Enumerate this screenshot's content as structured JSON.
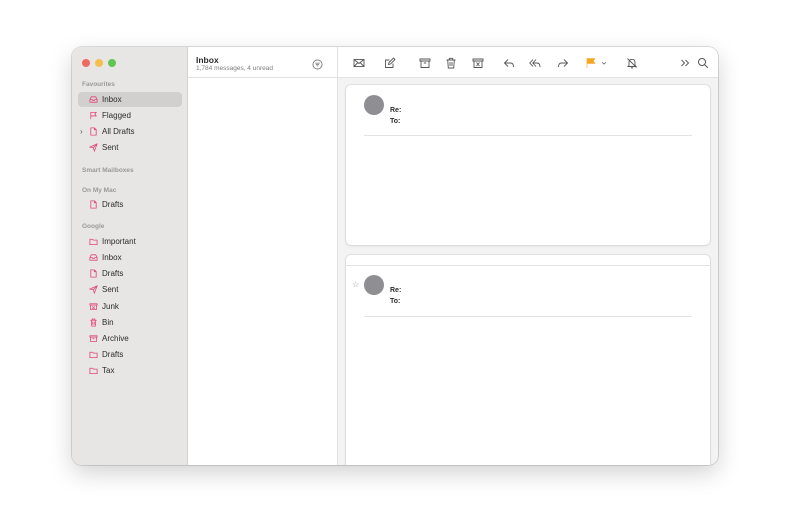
{
  "sidebar": {
    "sections": {
      "favourites": "Favourites",
      "smart_mailboxes": "Smart Mailboxes",
      "on_my_mac": "On My Mac",
      "google": "Google"
    },
    "favourites": [
      {
        "label": "Inbox",
        "icon": "inbox-icon",
        "selected": true
      },
      {
        "label": "Flagged",
        "icon": "flag-icon"
      },
      {
        "label": "All Drafts",
        "icon": "document-icon",
        "expandable": true
      },
      {
        "label": "Sent",
        "icon": "paper-plane-icon"
      }
    ],
    "on_my_mac": [
      {
        "label": "Drafts",
        "icon": "document-icon"
      }
    ],
    "google": [
      {
        "label": "Important",
        "icon": "folder-icon"
      },
      {
        "label": "Inbox",
        "icon": "inbox-icon"
      },
      {
        "label": "Drafts",
        "icon": "document-icon"
      },
      {
        "label": "Sent",
        "icon": "paper-plane-icon"
      },
      {
        "label": "Junk",
        "icon": "junk-icon"
      },
      {
        "label": "Bin",
        "icon": "trash-icon"
      },
      {
        "label": "Archive",
        "icon": "archive-icon"
      },
      {
        "label": "Drafts",
        "icon": "folder-icon"
      },
      {
        "label": "Tax",
        "icon": "folder-icon"
      }
    ],
    "accent_color": "#e2467a"
  },
  "message_list": {
    "title": "Inbox",
    "subtitle": "1,784 messages, 4 unread"
  },
  "toolbar": {
    "icons": [
      "envelope-icon",
      "compose-icon",
      "archive-icon",
      "trash-icon",
      "junk-icon",
      "reply-icon",
      "reply-all-icon",
      "forward-icon",
      "flag-icon",
      "chevron-down-icon",
      "mute-bell-icon",
      "more-chevrons-icon",
      "search-icon"
    ],
    "flag_color": "#f5a623"
  },
  "messages": [
    {
      "re_label": "Re:",
      "to_label": "To:"
    },
    {
      "re_label": "Re:",
      "to_label": "To:",
      "star": "☆"
    }
  ]
}
